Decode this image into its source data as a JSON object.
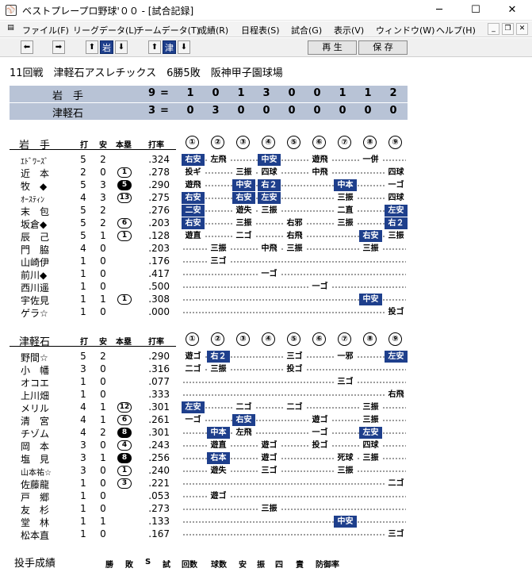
{
  "window": {
    "title": "ベストプレープロ野球'００ - [試合記録]",
    "minimize": "─",
    "maximize": "☐",
    "close": "✕"
  },
  "menu": {
    "items": [
      "ファイル(F)",
      "リーグデータ(L)",
      "チームデータ(T)",
      "成績(R)",
      "日程表(S)",
      "試合(G)",
      "表示(V)",
      "ウィンドウ(W)",
      "ヘルプ(H)"
    ],
    "mdi_minimize": "_",
    "mdi_restore": "❐",
    "mdi_close": "✕"
  },
  "toolbar": {
    "team_a": "岩",
    "team_b": "津",
    "replay": "再 生",
    "save": "保 存"
  },
  "game": {
    "info": "11回戦　津軽石アスレチックス　6勝5敗　阪神甲子園球場"
  },
  "scoreboard": {
    "rows": [
      {
        "team": "岩　手",
        "total": "9",
        "eq": "=",
        "innings": [
          "1",
          "0",
          "1",
          "3",
          "0",
          "0",
          "1",
          "1",
          "2"
        ]
      },
      {
        "team": "津軽石",
        "total": "3",
        "eq": "=",
        "innings": [
          "0",
          "3",
          "0",
          "0",
          "0",
          "0",
          "0",
          "0",
          "0"
        ]
      }
    ]
  },
  "columns": {
    "ab": "打",
    "hit": "安",
    "hr": "本塁",
    "avg": "打率"
  },
  "innings_labels": [
    "①",
    "②",
    "③",
    "④",
    "⑤",
    "⑥",
    "⑦",
    "⑧",
    "⑨"
  ],
  "teams": [
    {
      "name": "岩　手",
      "players": [
        {
          "name": "ｴﾄﾞﾜｰｽﾞ",
          "small": true,
          "ab": "5",
          "h": "2",
          "hr": "",
          "avg": ".324",
          "results": [
            {
              "i": 0,
              "t": "右安",
              "hit": true
            },
            {
              "i": 1,
              "t": "左飛"
            },
            {
              "i": 3,
              "t": "中安",
              "hit": true
            },
            {
              "i": 5,
              "t": "遊飛"
            },
            {
              "i": 7,
              "t": "一併"
            }
          ]
        },
        {
          "name": "近　本",
          "ab": "2",
          "h": "0",
          "hr": "1",
          "avg": ".278",
          "results": [
            {
              "i": 0,
              "t": "投ギ"
            },
            {
              "i": 2,
              "t": "三振"
            },
            {
              "i": 3,
              "t": "四球"
            },
            {
              "i": 5,
              "t": "中飛"
            },
            {
              "i": 8,
              "t": "四球"
            }
          ]
        },
        {
          "name": "牧　◆",
          "ab": "5",
          "h": "3",
          "hr": "5",
          "hrDark": true,
          "avg": ".290",
          "results": [
            {
              "i": 0,
              "t": "遊飛"
            },
            {
              "i": 2,
              "t": "中安",
              "hit": true
            },
            {
              "i": 3,
              "t": "右２",
              "hit": true
            },
            {
              "i": 6,
              "t": "中本",
              "hit": true
            },
            {
              "i": 8,
              "t": "一ゴ"
            }
          ]
        },
        {
          "name": "ｵｰｽﾃｨﾝ",
          "small": true,
          "ab": "4",
          "h": "3",
          "hr": "13",
          "avg": ".275",
          "results": [
            {
              "i": 0,
              "t": "右安",
              "hit": true
            },
            {
              "i": 2,
              "t": "右安",
              "hit": true
            },
            {
              "i": 3,
              "t": "左安",
              "hit": true
            },
            {
              "i": 6,
              "t": "三振"
            },
            {
              "i": 8,
              "t": "四球"
            }
          ]
        },
        {
          "name": "末　包",
          "ab": "5",
          "h": "2",
          "hr": "",
          "avg": ".276",
          "results": [
            {
              "i": 0,
              "t": "二安",
              "hit": true
            },
            {
              "i": 2,
              "t": "遊失"
            },
            {
              "i": 3,
              "t": "三振"
            },
            {
              "i": 6,
              "t": "二直"
            },
            {
              "i": 8,
              "t": "左安",
              "hit": true
            }
          ]
        },
        {
          "name": "坂倉◆",
          "ab": "5",
          "h": "2",
          "hr": "6",
          "avg": ".203",
          "results": [
            {
              "i": 0,
              "t": "右安",
              "hit": true
            },
            {
              "i": 2,
              "t": "三振"
            },
            {
              "i": 4,
              "t": "右邪"
            },
            {
              "i": 6,
              "t": "三振"
            },
            {
              "i": 8,
              "t": "右２",
              "hit": true
            }
          ]
        },
        {
          "name": "辰　己",
          "ab": "5",
          "h": "1",
          "hr": "1",
          "avg": ".128",
          "results": [
            {
              "i": 0,
              "t": "遊直"
            },
            {
              "i": 2,
              "t": "二ゴ"
            },
            {
              "i": 4,
              "t": "右飛"
            },
            {
              "i": 7,
              "t": "右安",
              "hit": true
            },
            {
              "i": 8,
              "t": "三振"
            }
          ]
        },
        {
          "name": "門　脇",
          "ab": "4",
          "h": "0",
          "hr": "",
          "avg": ".203",
          "results": [
            {
              "i": 1,
              "t": "三振"
            },
            {
              "i": 3,
              "t": "中飛"
            },
            {
              "i": 4,
              "t": "三振"
            },
            {
              "i": 7,
              "t": "三振"
            }
          ]
        },
        {
          "name": "山崎伊",
          "ab": "1",
          "h": "0",
          "hr": "",
          "avg": ".176",
          "results": [
            {
              "i": 1,
              "t": "三ゴ"
            }
          ]
        },
        {
          "name": "前川◆",
          "ab": "1",
          "h": "0",
          "hr": "",
          "avg": ".417",
          "results": [
            {
              "i": 3,
              "t": "一ゴ"
            }
          ]
        },
        {
          "name": "西川遥",
          "ab": "1",
          "h": "0",
          "hr": "",
          "avg": ".500",
          "results": [
            {
              "i": 5,
              "t": "一ゴ"
            }
          ]
        },
        {
          "name": "宇佐見",
          "ab": "1",
          "h": "1",
          "hr": "1",
          "avg": ".308",
          "results": [
            {
              "i": 7,
              "t": "中安",
              "hit": true
            }
          ]
        },
        {
          "name": "ゲラ☆",
          "ab": "1",
          "h": "0",
          "hr": "",
          "avg": ".000",
          "results": [
            {
              "i": 8,
              "t": "投ゴ"
            }
          ]
        }
      ]
    },
    {
      "name": "津軽石",
      "players": [
        {
          "name": "野間☆",
          "ab": "5",
          "h": "2",
          "hr": "",
          "avg": ".290",
          "results": [
            {
              "i": 0,
              "t": "遊ゴ"
            },
            {
              "i": 1,
              "t": "右２",
              "hit": true
            },
            {
              "i": 4,
              "t": "三ゴ"
            },
            {
              "i": 6,
              "t": "一邪"
            },
            {
              "i": 8,
              "t": "左安",
              "hit": true
            }
          ]
        },
        {
          "name": "小　幡",
          "ab": "3",
          "h": "0",
          "hr": "",
          "avg": ".316",
          "results": [
            {
              "i": 0,
              "t": "二ゴ"
            },
            {
              "i": 1,
              "t": "三振"
            },
            {
              "i": 4,
              "t": "投ゴ"
            }
          ]
        },
        {
          "name": "オコエ",
          "ab": "1",
          "h": "0",
          "hr": "",
          "avg": ".077",
          "results": [
            {
              "i": 6,
              "t": "三ゴ"
            }
          ]
        },
        {
          "name": "上川畑",
          "ab": "1",
          "h": "0",
          "hr": "",
          "avg": ".333",
          "results": [
            {
              "i": 8,
              "t": "右飛"
            }
          ]
        },
        {
          "name": "メリル",
          "ab": "4",
          "h": "1",
          "hr": "12",
          "avg": ".301",
          "results": [
            {
              "i": 0,
              "t": "左安",
              "hit": true
            },
            {
              "i": 2,
              "t": "二ゴ"
            },
            {
              "i": 4,
              "t": "二ゴ"
            },
            {
              "i": 7,
              "t": "三振"
            }
          ]
        },
        {
          "name": "清　宮",
          "ab": "4",
          "h": "1",
          "hr": "6",
          "avg": ".261",
          "results": [
            {
              "i": 0,
              "t": "一ゴ"
            },
            {
              "i": 2,
              "t": "右安",
              "hit": true
            },
            {
              "i": 5,
              "t": "遊ゴ"
            },
            {
              "i": 7,
              "t": "三振"
            }
          ]
        },
        {
          "name": "チゾム",
          "ab": "4",
          "h": "2",
          "hr": "8",
          "hrDark": true,
          "avg": ".301",
          "results": [
            {
              "i": 1,
              "t": "中本",
              "hit": true
            },
            {
              "i": 2,
              "t": "左飛"
            },
            {
              "i": 5,
              "t": "一ゴ"
            },
            {
              "i": 7,
              "t": "左安",
              "hit": true
            }
          ]
        },
        {
          "name": "岡　本",
          "ab": "3",
          "h": "0",
          "hr": "4",
          "avg": ".243",
          "results": [
            {
              "i": 1,
              "t": "遊直"
            },
            {
              "i": 3,
              "t": "遊ゴ"
            },
            {
              "i": 5,
              "t": "投ゴ"
            },
            {
              "i": 7,
              "t": "四球"
            }
          ]
        },
        {
          "name": "塩　見",
          "ab": "3",
          "h": "1",
          "hr": "8",
          "hrDark": true,
          "avg": ".256",
          "results": [
            {
              "i": 1,
              "t": "右本",
              "hit": true
            },
            {
              "i": 3,
              "t": "遊ゴ"
            },
            {
              "i": 6,
              "t": "死球"
            },
            {
              "i": 7,
              "t": "三振"
            }
          ]
        },
        {
          "name": "山本祐☆",
          "small": true,
          "ab": "3",
          "h": "0",
          "hr": "1",
          "avg": ".240",
          "results": [
            {
              "i": 1,
              "t": "遊失"
            },
            {
              "i": 3,
              "t": "三ゴ"
            },
            {
              "i": 6,
              "t": "三振"
            }
          ]
        },
        {
          "name": "佐藤龍",
          "ab": "1",
          "h": "0",
          "hr": "3",
          "avg": ".221",
          "results": [
            {
              "i": 8,
              "t": "二ゴ"
            }
          ]
        },
        {
          "name": "戸　郷",
          "ab": "1",
          "h": "0",
          "hr": "",
          "avg": ".053",
          "results": [
            {
              "i": 1,
              "t": "遊ゴ"
            }
          ]
        },
        {
          "name": "友　杉",
          "ab": "1",
          "h": "0",
          "hr": "",
          "avg": ".273",
          "results": [
            {
              "i": 3,
              "t": "三振"
            }
          ]
        },
        {
          "name": "堂　林",
          "ab": "1",
          "h": "1",
          "hr": "",
          "avg": ".133",
          "results": [
            {
              "i": 6,
              "t": "中安",
              "hit": true
            }
          ]
        },
        {
          "name": "松本直",
          "ab": "1",
          "h": "0",
          "hr": "",
          "avg": ".167",
          "results": [
            {
              "i": 8,
              "t": "三ゴ"
            }
          ]
        }
      ]
    }
  ],
  "pitching": {
    "title": "投手成績",
    "headers": [
      "勝",
      "敗",
      "S",
      "試",
      "回数",
      "球数",
      "安",
      "振",
      "四",
      "責",
      "防御率"
    ]
  }
}
